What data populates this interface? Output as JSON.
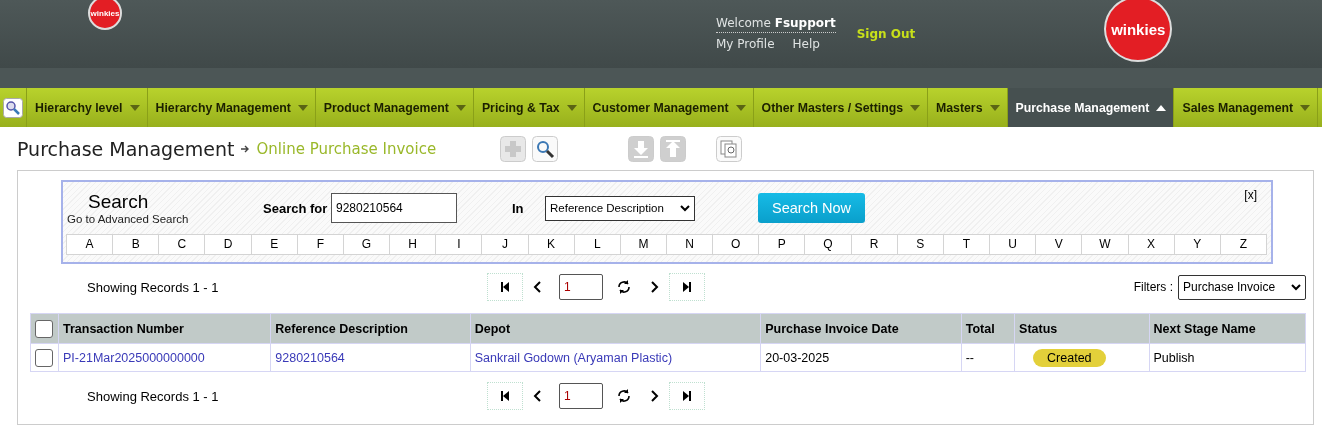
{
  "header": {
    "logos": [
      {
        "text": "winkies"
      },
      {
        "text": "winkies"
      }
    ],
    "welcome": "Welcome",
    "user": "Fsupport",
    "links": [
      "My Profile",
      "Help"
    ],
    "sign_out": "Sign Out"
  },
  "nav": {
    "items": [
      {
        "label": "Hierarchy level",
        "selected": false
      },
      {
        "label": "Hierarchy Management",
        "selected": false
      },
      {
        "label": "Product Management",
        "selected": false
      },
      {
        "label": "Pricing & Tax",
        "selected": false
      },
      {
        "label": "Customer Management",
        "selected": false
      },
      {
        "label": "Other Masters / Settings",
        "selected": false
      },
      {
        "label": "Masters",
        "selected": false
      },
      {
        "label": "Purchase Management",
        "selected": true
      },
      {
        "label": "Sales Management",
        "selected": false
      }
    ]
  },
  "breadcrumb": {
    "section": "Purchase Management",
    "page": "Online Purchase Invoice"
  },
  "toolbar": [
    {
      "kind": "add",
      "disabled": true
    },
    {
      "kind": "search",
      "disabled": false
    },
    {
      "kind": "download",
      "disabled": true
    },
    {
      "kind": "upload",
      "disabled": true
    },
    {
      "kind": "copy",
      "disabled": false
    }
  ],
  "search": {
    "title": "Search",
    "advanced_link": "Go to Advanced Search",
    "label": "Search for",
    "value": "9280210564",
    "in_label": "In",
    "in_value": "Reference Description",
    "button": "Search Now",
    "close": "[x]",
    "letters": [
      "A",
      "B",
      "C",
      "D",
      "E",
      "F",
      "G",
      "H",
      "I",
      "J",
      "K",
      "L",
      "M",
      "N",
      "O",
      "P",
      "Q",
      "R",
      "S",
      "T",
      "U",
      "V",
      "W",
      "X",
      "Y",
      "Z"
    ]
  },
  "pager_top": {
    "records": "Showing Records 1 - 1",
    "page": "1"
  },
  "filters": {
    "label": "Filters :",
    "value": "Purchase Invoice"
  },
  "table": {
    "all_checked": false,
    "columns": [
      "Transaction Number",
      "Reference Description",
      "Depot",
      "Purchase Invoice Date",
      "Total",
      "Status",
      "Next Stage Name"
    ],
    "rows": [
      {
        "checked": false,
        "cells": [
          {
            "kind": "link",
            "text": "PI-21Mar2025000000000"
          },
          {
            "kind": "link",
            "text": "9280210564"
          },
          {
            "kind": "link",
            "text": "Sankrail Godown (Aryaman Plastic)"
          },
          {
            "kind": "text",
            "text": "20-03-2025"
          },
          {
            "kind": "text",
            "text": "--"
          },
          {
            "kind": "badge",
            "text": "Created"
          },
          {
            "kind": "text",
            "text": "Publish"
          }
        ]
      }
    ]
  },
  "pager_bottom": {
    "records": "Showing Records 1 - 1",
    "page": "1"
  }
}
